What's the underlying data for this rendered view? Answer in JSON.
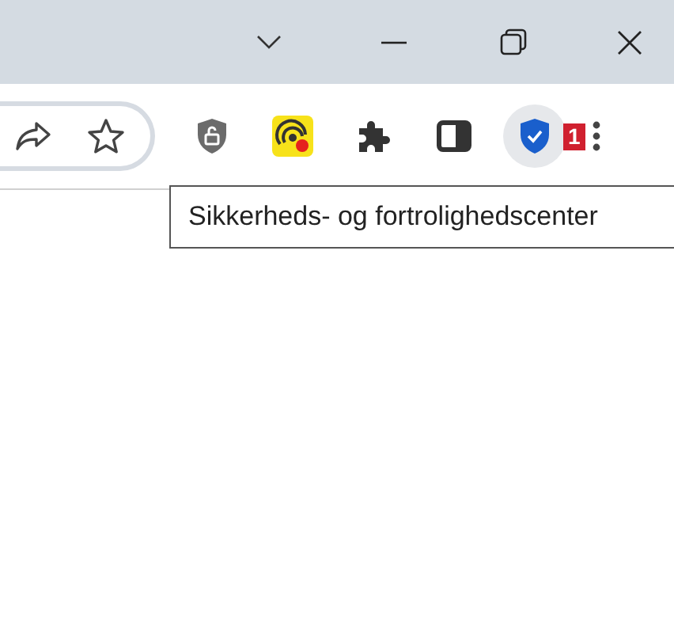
{
  "toolbar": {
    "items": [
      {
        "kind": "share",
        "active": false
      },
      {
        "kind": "star",
        "active": false
      },
      {
        "kind": "lock-shield",
        "active": false
      },
      {
        "kind": "yellow-app",
        "active": false
      },
      {
        "kind": "puzzle",
        "active": false
      },
      {
        "kind": "side-panel",
        "active": false
      },
      {
        "kind": "check-shield",
        "active": true,
        "badge": "1"
      },
      {
        "kind": "menu",
        "active": false
      }
    ]
  },
  "tooltip": {
    "text": "Sikkerheds- og fortrolighedscenter"
  }
}
